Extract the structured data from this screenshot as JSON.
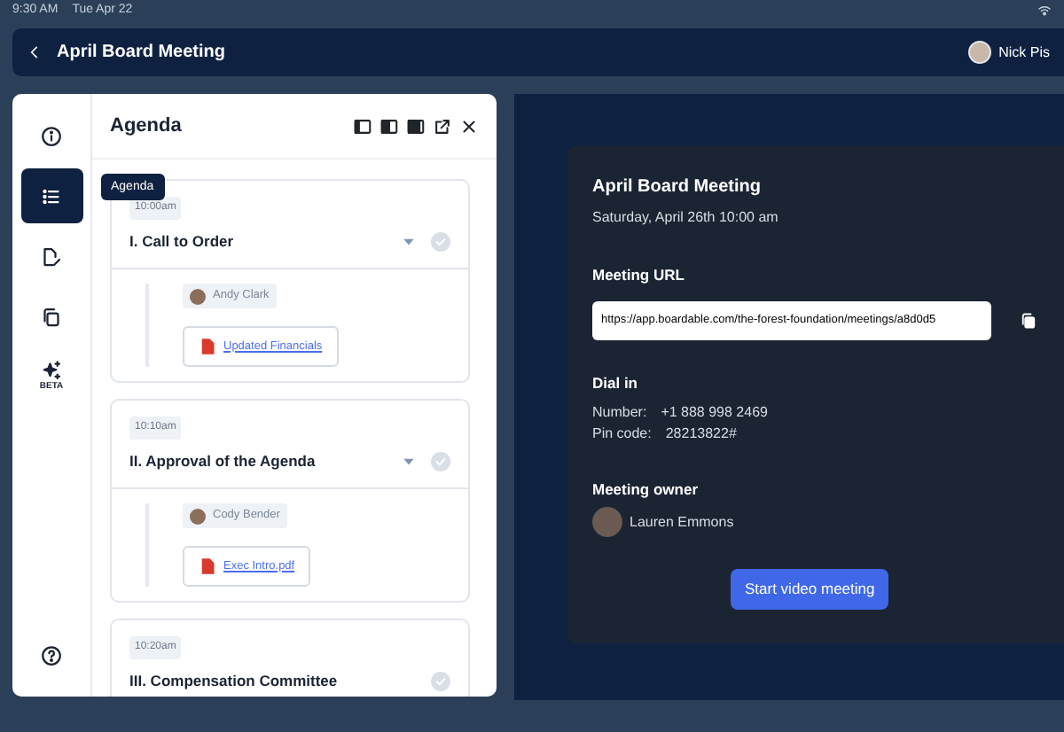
{
  "status_bar": {
    "time": "9:30 AM",
    "date": "Tue Apr 22"
  },
  "header": {
    "title": "April Board Meeting",
    "user": {
      "name": "Nick Pis"
    }
  },
  "rail": {
    "items": [
      {
        "kind": "info",
        "selected": false
      },
      {
        "kind": "list",
        "selected": true,
        "tooltip": "Agenda"
      },
      {
        "kind": "edit",
        "selected": false
      },
      {
        "kind": "copy",
        "selected": false
      },
      {
        "kind": "sparkle",
        "selected": false,
        "label": "BETA"
      }
    ]
  },
  "agenda": {
    "title": "Agenda",
    "items": [
      {
        "time": "10:00am",
        "title": "I. Call to Order",
        "completed": false,
        "attendee": "Andy Clark",
        "file": "Updated Financials"
      },
      {
        "time": "10:10am",
        "title": "II. Approval of the Agenda",
        "completed": false,
        "attendee": "Cody Bender",
        "file": "Exec Intro.pdf"
      },
      {
        "time": "10:20am",
        "title": "III. Compensation Committee",
        "completed": false
      }
    ]
  },
  "meeting": {
    "title": "April Board Meeting",
    "date": "Saturday, April 26th 10:00 am",
    "url_label": "Meeting URL",
    "url": "https://app.boardable.com/the-forest-foundation/meetings/a8d0d5",
    "dial_label": "Dial in",
    "number_label": "Number:",
    "number": "+1 888 998 2469",
    "pin_label": "Pin code:",
    "pin": "28213822#",
    "owner_label": "Meeting owner",
    "owner": "Lauren Emmons",
    "button": "Start video meeting"
  }
}
